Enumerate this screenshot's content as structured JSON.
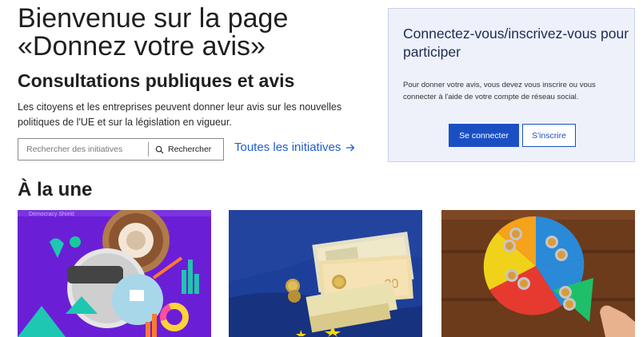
{
  "hero": {
    "title": "Bienvenue sur la page «Donnez votre avis»",
    "subtitle": "Consultations publiques et avis",
    "description": "Les citoyens et les entreprises peuvent donner leur avis sur les nouvelles politiques de l'UE et sur la législation en vigueur."
  },
  "search": {
    "placeholder": "Rechercher des initiatives",
    "button_label": "Rechercher"
  },
  "all_initiatives_link": "Toutes les initiatives",
  "login": {
    "title": "Connectez-vous/inscrivez-vous pour participer",
    "text": "Pour donner votre avis, vous devez vous inscrire ou vous connecter à l'aide de votre compte de réseau social.",
    "login_button": "Se connecter",
    "register_button": "S'inscrire"
  },
  "featured": {
    "title": "À la une",
    "cards": [
      {
        "image_caption": "Democracy Shield",
        "icon": "collage-image"
      },
      {
        "icon": "euro-banknotes-image"
      },
      {
        "icon": "pie-chart-coins-image"
      }
    ]
  },
  "colors": {
    "primary": "#1a4fc4",
    "link": "#1f5fd1",
    "card_bg": "#eef1fa"
  }
}
